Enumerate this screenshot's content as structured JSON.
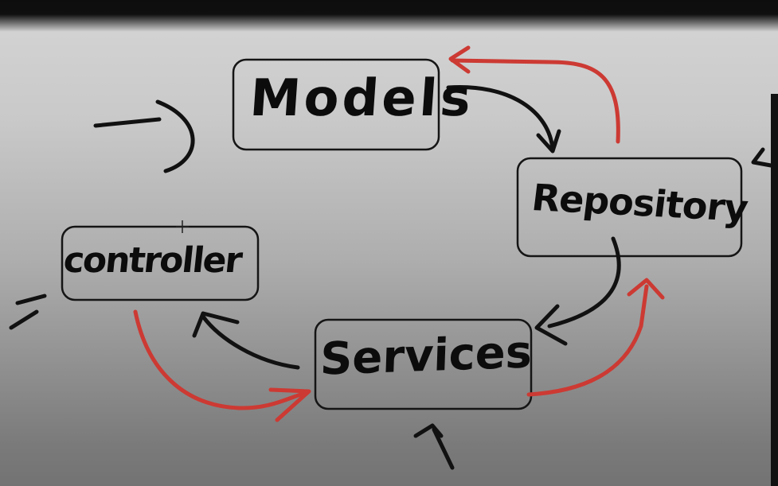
{
  "diagram": {
    "nodes": [
      {
        "id": "models",
        "label": "Models"
      },
      {
        "id": "repository",
        "label": "Repository"
      },
      {
        "id": "services",
        "label": "Services"
      },
      {
        "id": "controller",
        "label": "controller"
      }
    ],
    "edges": [
      {
        "from": "models",
        "to": "repository",
        "color": "#111111"
      },
      {
        "from": "repository",
        "to": "services",
        "color": "#111111"
      },
      {
        "from": "services",
        "to": "controller",
        "color": "#111111"
      },
      {
        "from": "controller",
        "to": "services",
        "color": "#cc3a33"
      },
      {
        "from": "services",
        "to": "repository",
        "color": "#cc3a33"
      },
      {
        "from": "repository",
        "to": "models",
        "color": "#cc3a33"
      }
    ],
    "colors": {
      "ink": "#111111",
      "red": "#cc3a33"
    }
  }
}
